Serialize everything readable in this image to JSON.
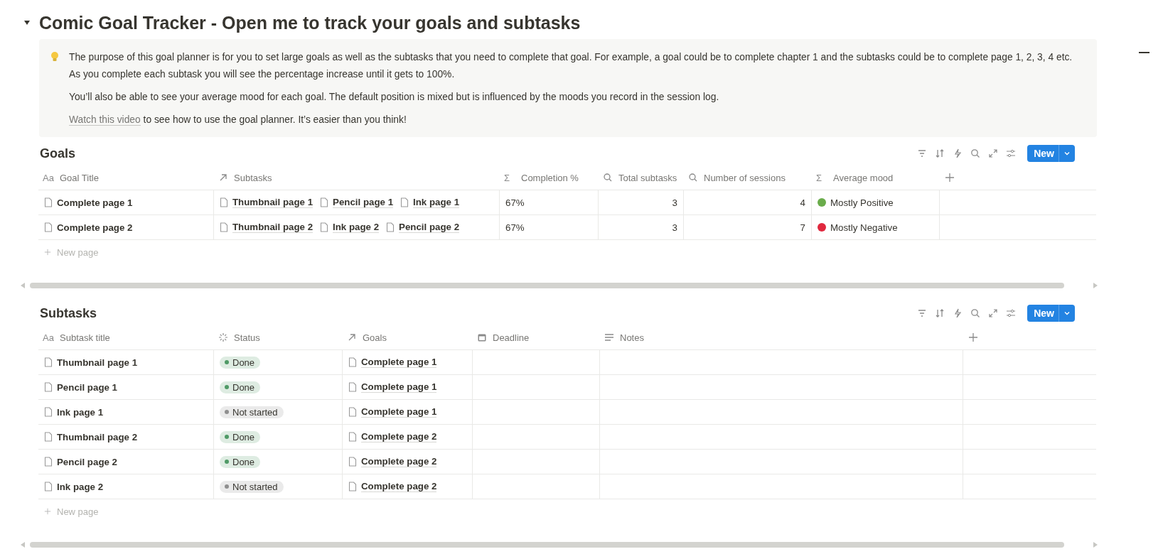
{
  "page": {
    "title": "Comic Goal Tracker - Open me to track your goals and subtasks",
    "expanded": true
  },
  "callout": {
    "paragraphs": [
      "The purpose of this goal planner is for you to set large goals as well as the subtasks that you need to complete that goal. For example, a goal could be to complete chapter 1 and the subtasks could be to complete page 1, 2, 3, 4 etc. As you complete each subtask you will see the percentage increase until it gets to 100%.",
      "You’ll also be able to see your average mood for each goal. The default position is mixed but is influenced by the moods you record in the session log."
    ],
    "video_line": {
      "link": "Watch this video",
      "text": "to see how to use the goal planner. It’s easier than you think!"
    }
  },
  "databases": [
    {
      "title": "Goals",
      "new_button": "New",
      "new_row": "New page",
      "columns": [
        {
          "label": "Goal Title",
          "kind": "title",
          "icon_text": "Aa"
        },
        {
          "label": "Subtasks",
          "kind": "relation"
        },
        {
          "label": "Completion %",
          "kind": "formula",
          "icon_text": "Σ"
        },
        {
          "label": "Total subtasks",
          "kind": "rollup"
        },
        {
          "label": "Number of sessions",
          "kind": "rollup"
        },
        {
          "label": "Average mood",
          "kind": "formula",
          "icon_text": "Σ"
        }
      ],
      "rows": [
        {
          "cells": [
            "Complete page 1",
            [
              "Thumbnail page 1",
              "Pencil page 1",
              "Ink page 1"
            ],
            "67%",
            "3",
            "4",
            {
              "label": "Mostly Positive",
              "color": "#6aac4b"
            }
          ]
        },
        {
          "cells": [
            "Complete page 2",
            [
              "Thumbnail page 2",
              "Ink page 2",
              "Pencil page 2"
            ],
            "67%",
            "3",
            "7",
            {
              "label": "Mostly Negative",
              "color": "#e0283e"
            }
          ]
        }
      ]
    },
    {
      "title": "Subtasks",
      "new_button": "New",
      "new_row": "New page",
      "columns": [
        {
          "label": "Subtask title",
          "kind": "title",
          "icon_text": "Aa"
        },
        {
          "label": "Status",
          "kind": "status"
        },
        {
          "label": "Goals",
          "kind": "relation"
        },
        {
          "label": "Deadline",
          "kind": "date"
        },
        {
          "label": "Notes",
          "kind": "text"
        }
      ],
      "rows": [
        {
          "cells": [
            "Thumbnail page 1",
            {
              "label": "Done",
              "color": "#4f9a66"
            },
            [
              "Complete page 1"
            ]
          ]
        },
        {
          "cells": [
            "Pencil page 1",
            {
              "label": "Done",
              "color": "#4f9a66"
            },
            [
              "Complete page 1"
            ]
          ]
        },
        {
          "cells": [
            "Ink page 1",
            {
              "label": "Not started",
              "color": "#8f8f8f"
            },
            [
              "Complete page 1"
            ]
          ]
        },
        {
          "cells": [
            "Thumbnail page 2",
            {
              "label": "Done",
              "color": "#4f9a66"
            },
            [
              "Complete page 2"
            ]
          ]
        },
        {
          "cells": [
            "Pencil page 2",
            {
              "label": "Done",
              "color": "#4f9a66"
            },
            [
              "Complete page 2"
            ]
          ]
        },
        {
          "cells": [
            "Ink page 2",
            {
              "label": "Not started",
              "color": "#8f8f8f"
            },
            [
              "Complete page 2"
            ]
          ]
        }
      ]
    }
  ]
}
